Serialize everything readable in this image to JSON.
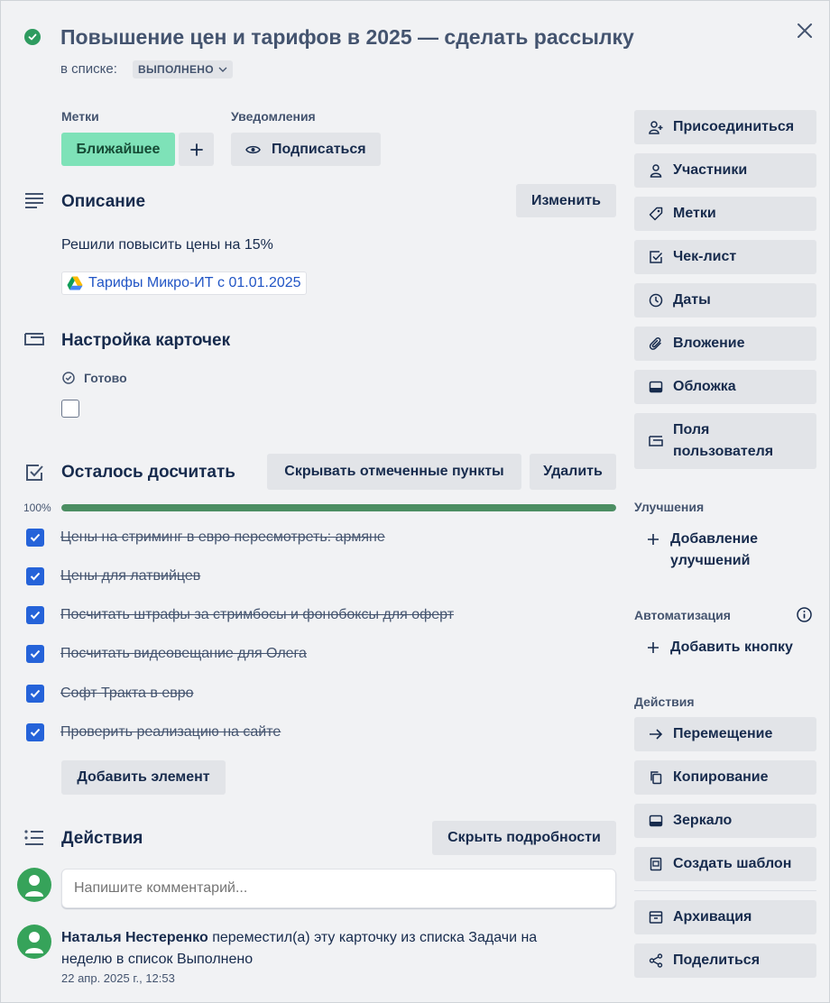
{
  "header": {
    "title": "Повышение цен и тарифов в 2025 — сделать рассылку",
    "in_list_prefix": "в списке:",
    "list_name": "ВЫПОЛНЕНО"
  },
  "labels": {
    "heading": "Метки",
    "items": [
      "Ближайшее"
    ],
    "label_color": "#7ee2b8"
  },
  "notifications": {
    "heading": "Уведомления",
    "subscribe_label": "Подписаться"
  },
  "description": {
    "heading": "Описание",
    "edit_label": "Изменить",
    "text": "Решили повысить цены на 15%",
    "attachment_link": "Тарифы Микро-ИТ с 01.01.2025"
  },
  "card_settings": {
    "heading": "Настройка карточек",
    "field_label": "Готово"
  },
  "checklist": {
    "heading": "Осталось досчитать",
    "hide_checked_label": "Скрывать отмеченные пункты",
    "delete_label": "Удалить",
    "progress_text": "100%",
    "progress_fraction": 1.0,
    "progress_color": "#4b8e62",
    "items": [
      "Цены на стриминг в евро пересмотреть: армяне",
      "Цены для латвийцев",
      "Посчитать штрафы за стримбосы и фонобоксы для оферт",
      "Посчитать видеовещание для Олега",
      "Софт Тракта в евро",
      "Проверить реализацию на сайте"
    ],
    "add_item_label": "Добавить элемент"
  },
  "activity": {
    "heading": "Действия",
    "hide_details_label": "Скрыть подробности",
    "comment_placeholder": "Напишите комментарий...",
    "entry": {
      "user": "Наталья Нестеренко",
      "text_line1": "переместил(а) эту карточку из списка Задачи на",
      "text_line2": "неделю в список Выполнено",
      "timestamp": "22 апр. 2025 г., 12:53"
    }
  },
  "sidebar": {
    "top_buttons": [
      "Присоединиться",
      "Участники",
      "Метки",
      "Чек-лист",
      "Даты",
      "Вложение",
      "Обложка"
    ],
    "custom_fields_line1": "Поля",
    "custom_fields_line2": "пользователя",
    "powerups_heading": "Улучшения",
    "add_powerups_line1": "Добавление",
    "add_powerups_line2": "улучшений",
    "automation_heading": "Автоматизация",
    "add_button_label": "Добавить кнопку",
    "actions_heading": "Действия",
    "action_buttons": [
      "Перемещение",
      "Копирование",
      "Зеркало",
      "Создать шаблон"
    ],
    "archive_label": "Архивация",
    "share_label": "Поделиться"
  },
  "colors": {
    "accent": "#2563d9",
    "complete": "#2e9b5f",
    "avatar": "#36a35a",
    "link": "#2155c5"
  }
}
